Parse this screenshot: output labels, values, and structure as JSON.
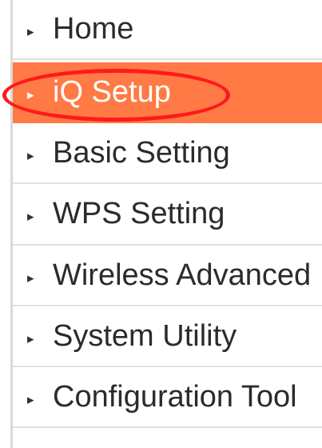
{
  "menu": {
    "items": [
      {
        "id": "home",
        "label": "Home",
        "icon": "triangle-right-icon",
        "active": false
      },
      {
        "id": "iq-setup",
        "label": "iQ Setup",
        "icon": "triangle-right-icon",
        "active": true
      },
      {
        "id": "basic-setting",
        "label": "Basic Setting",
        "icon": "triangle-right-icon",
        "active": false
      },
      {
        "id": "wps-setting",
        "label": "WPS Setting",
        "icon": "triangle-right-icon",
        "active": false
      },
      {
        "id": "wireless-advanced",
        "label": "Wireless Advanced",
        "icon": "triangle-right-icon",
        "active": false
      },
      {
        "id": "system-utility",
        "label": "System Utility",
        "icon": "triangle-right-icon",
        "active": false
      },
      {
        "id": "configuration-tool",
        "label": "Configuration Tool",
        "icon": "triangle-right-icon",
        "active": false
      }
    ]
  },
  "colors": {
    "active_bg": "#ff7a45",
    "text": "#2b2b2b",
    "divider": "#e2e2e2",
    "annotation": "#ff1a1a"
  },
  "icons": {
    "arrow": "▸"
  }
}
